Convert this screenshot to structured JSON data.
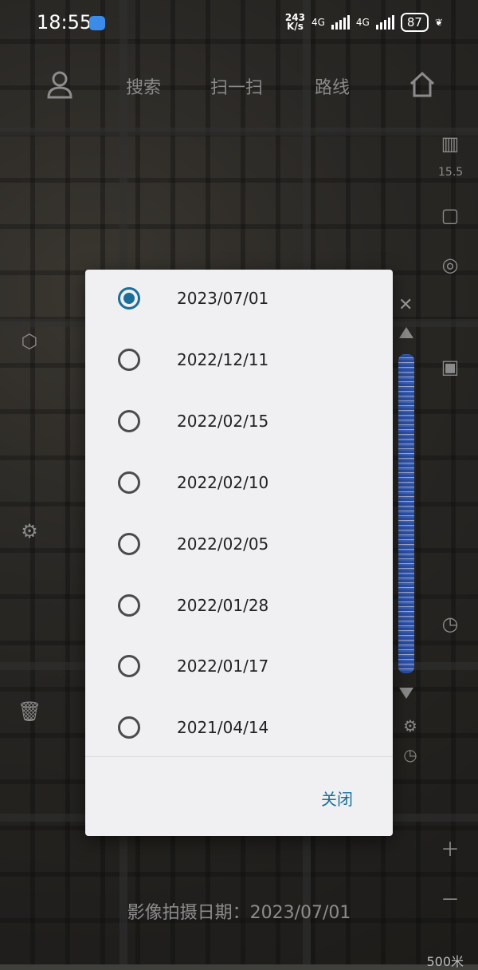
{
  "status_bar": {
    "time": "18:55",
    "net_speed": "243\nK/s",
    "sig1_label": "4G",
    "sig2_label": "4G",
    "battery": "87"
  },
  "top_nav": {
    "search": "搜索",
    "scan": "扫一扫",
    "route": "路线"
  },
  "right_toolbar_number": "15.5",
  "dialog": {
    "options": [
      {
        "label": "2023/07/01",
        "selected": true
      },
      {
        "label": "2022/12/11",
        "selected": false
      },
      {
        "label": "2022/02/15",
        "selected": false
      },
      {
        "label": "2022/02/10",
        "selected": false
      },
      {
        "label": "2022/02/05",
        "selected": false
      },
      {
        "label": "2022/01/28",
        "selected": false
      },
      {
        "label": "2022/01/17",
        "selected": false
      },
      {
        "label": "2021/04/14",
        "selected": false
      }
    ],
    "close_label": "关闭"
  },
  "bottom": {
    "capture_date": "影像拍摄日期：2023/07/01",
    "scale": "500米"
  },
  "colors": {
    "accent": "#1b6f98",
    "dialog_bg": "#f0f0f2"
  }
}
